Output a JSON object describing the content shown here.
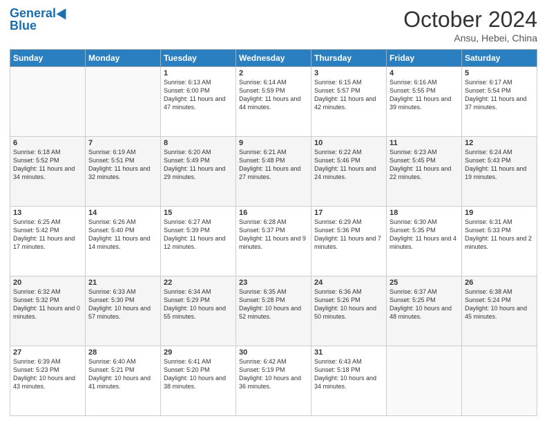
{
  "header": {
    "logo_line1": "General",
    "logo_line2": "Blue",
    "month_title": "October 2024",
    "location": "Ansu, Hebei, China"
  },
  "days_of_week": [
    "Sunday",
    "Monday",
    "Tuesday",
    "Wednesday",
    "Thursday",
    "Friday",
    "Saturday"
  ],
  "weeks": [
    [
      {
        "num": "",
        "info": ""
      },
      {
        "num": "",
        "info": ""
      },
      {
        "num": "1",
        "info": "Sunrise: 6:13 AM\nSunset: 6:00 PM\nDaylight: 11 hours and 47 minutes."
      },
      {
        "num": "2",
        "info": "Sunrise: 6:14 AM\nSunset: 5:59 PM\nDaylight: 11 hours and 44 minutes."
      },
      {
        "num": "3",
        "info": "Sunrise: 6:15 AM\nSunset: 5:57 PM\nDaylight: 11 hours and 42 minutes."
      },
      {
        "num": "4",
        "info": "Sunrise: 6:16 AM\nSunset: 5:55 PM\nDaylight: 11 hours and 39 minutes."
      },
      {
        "num": "5",
        "info": "Sunrise: 6:17 AM\nSunset: 5:54 PM\nDaylight: 11 hours and 37 minutes."
      }
    ],
    [
      {
        "num": "6",
        "info": "Sunrise: 6:18 AM\nSunset: 5:52 PM\nDaylight: 11 hours and 34 minutes."
      },
      {
        "num": "7",
        "info": "Sunrise: 6:19 AM\nSunset: 5:51 PM\nDaylight: 11 hours and 32 minutes."
      },
      {
        "num": "8",
        "info": "Sunrise: 6:20 AM\nSunset: 5:49 PM\nDaylight: 11 hours and 29 minutes."
      },
      {
        "num": "9",
        "info": "Sunrise: 6:21 AM\nSunset: 5:48 PM\nDaylight: 11 hours and 27 minutes."
      },
      {
        "num": "10",
        "info": "Sunrise: 6:22 AM\nSunset: 5:46 PM\nDaylight: 11 hours and 24 minutes."
      },
      {
        "num": "11",
        "info": "Sunrise: 6:23 AM\nSunset: 5:45 PM\nDaylight: 11 hours and 22 minutes."
      },
      {
        "num": "12",
        "info": "Sunrise: 6:24 AM\nSunset: 5:43 PM\nDaylight: 11 hours and 19 minutes."
      }
    ],
    [
      {
        "num": "13",
        "info": "Sunrise: 6:25 AM\nSunset: 5:42 PM\nDaylight: 11 hours and 17 minutes."
      },
      {
        "num": "14",
        "info": "Sunrise: 6:26 AM\nSunset: 5:40 PM\nDaylight: 11 hours and 14 minutes."
      },
      {
        "num": "15",
        "info": "Sunrise: 6:27 AM\nSunset: 5:39 PM\nDaylight: 11 hours and 12 minutes."
      },
      {
        "num": "16",
        "info": "Sunrise: 6:28 AM\nSunset: 5:37 PM\nDaylight: 11 hours and 9 minutes."
      },
      {
        "num": "17",
        "info": "Sunrise: 6:29 AM\nSunset: 5:36 PM\nDaylight: 11 hours and 7 minutes."
      },
      {
        "num": "18",
        "info": "Sunrise: 6:30 AM\nSunset: 5:35 PM\nDaylight: 11 hours and 4 minutes."
      },
      {
        "num": "19",
        "info": "Sunrise: 6:31 AM\nSunset: 5:33 PM\nDaylight: 11 hours and 2 minutes."
      }
    ],
    [
      {
        "num": "20",
        "info": "Sunrise: 6:32 AM\nSunset: 5:32 PM\nDaylight: 11 hours and 0 minutes."
      },
      {
        "num": "21",
        "info": "Sunrise: 6:33 AM\nSunset: 5:30 PM\nDaylight: 10 hours and 57 minutes."
      },
      {
        "num": "22",
        "info": "Sunrise: 6:34 AM\nSunset: 5:29 PM\nDaylight: 10 hours and 55 minutes."
      },
      {
        "num": "23",
        "info": "Sunrise: 6:35 AM\nSunset: 5:28 PM\nDaylight: 10 hours and 52 minutes."
      },
      {
        "num": "24",
        "info": "Sunrise: 6:36 AM\nSunset: 5:26 PM\nDaylight: 10 hours and 50 minutes."
      },
      {
        "num": "25",
        "info": "Sunrise: 6:37 AM\nSunset: 5:25 PM\nDaylight: 10 hours and 48 minutes."
      },
      {
        "num": "26",
        "info": "Sunrise: 6:38 AM\nSunset: 5:24 PM\nDaylight: 10 hours and 45 minutes."
      }
    ],
    [
      {
        "num": "27",
        "info": "Sunrise: 6:39 AM\nSunset: 5:23 PM\nDaylight: 10 hours and 43 minutes."
      },
      {
        "num": "28",
        "info": "Sunrise: 6:40 AM\nSunset: 5:21 PM\nDaylight: 10 hours and 41 minutes."
      },
      {
        "num": "29",
        "info": "Sunrise: 6:41 AM\nSunset: 5:20 PM\nDaylight: 10 hours and 38 minutes."
      },
      {
        "num": "30",
        "info": "Sunrise: 6:42 AM\nSunset: 5:19 PM\nDaylight: 10 hours and 36 minutes."
      },
      {
        "num": "31",
        "info": "Sunrise: 6:43 AM\nSunset: 5:18 PM\nDaylight: 10 hours and 34 minutes."
      },
      {
        "num": "",
        "info": ""
      },
      {
        "num": "",
        "info": ""
      }
    ]
  ]
}
